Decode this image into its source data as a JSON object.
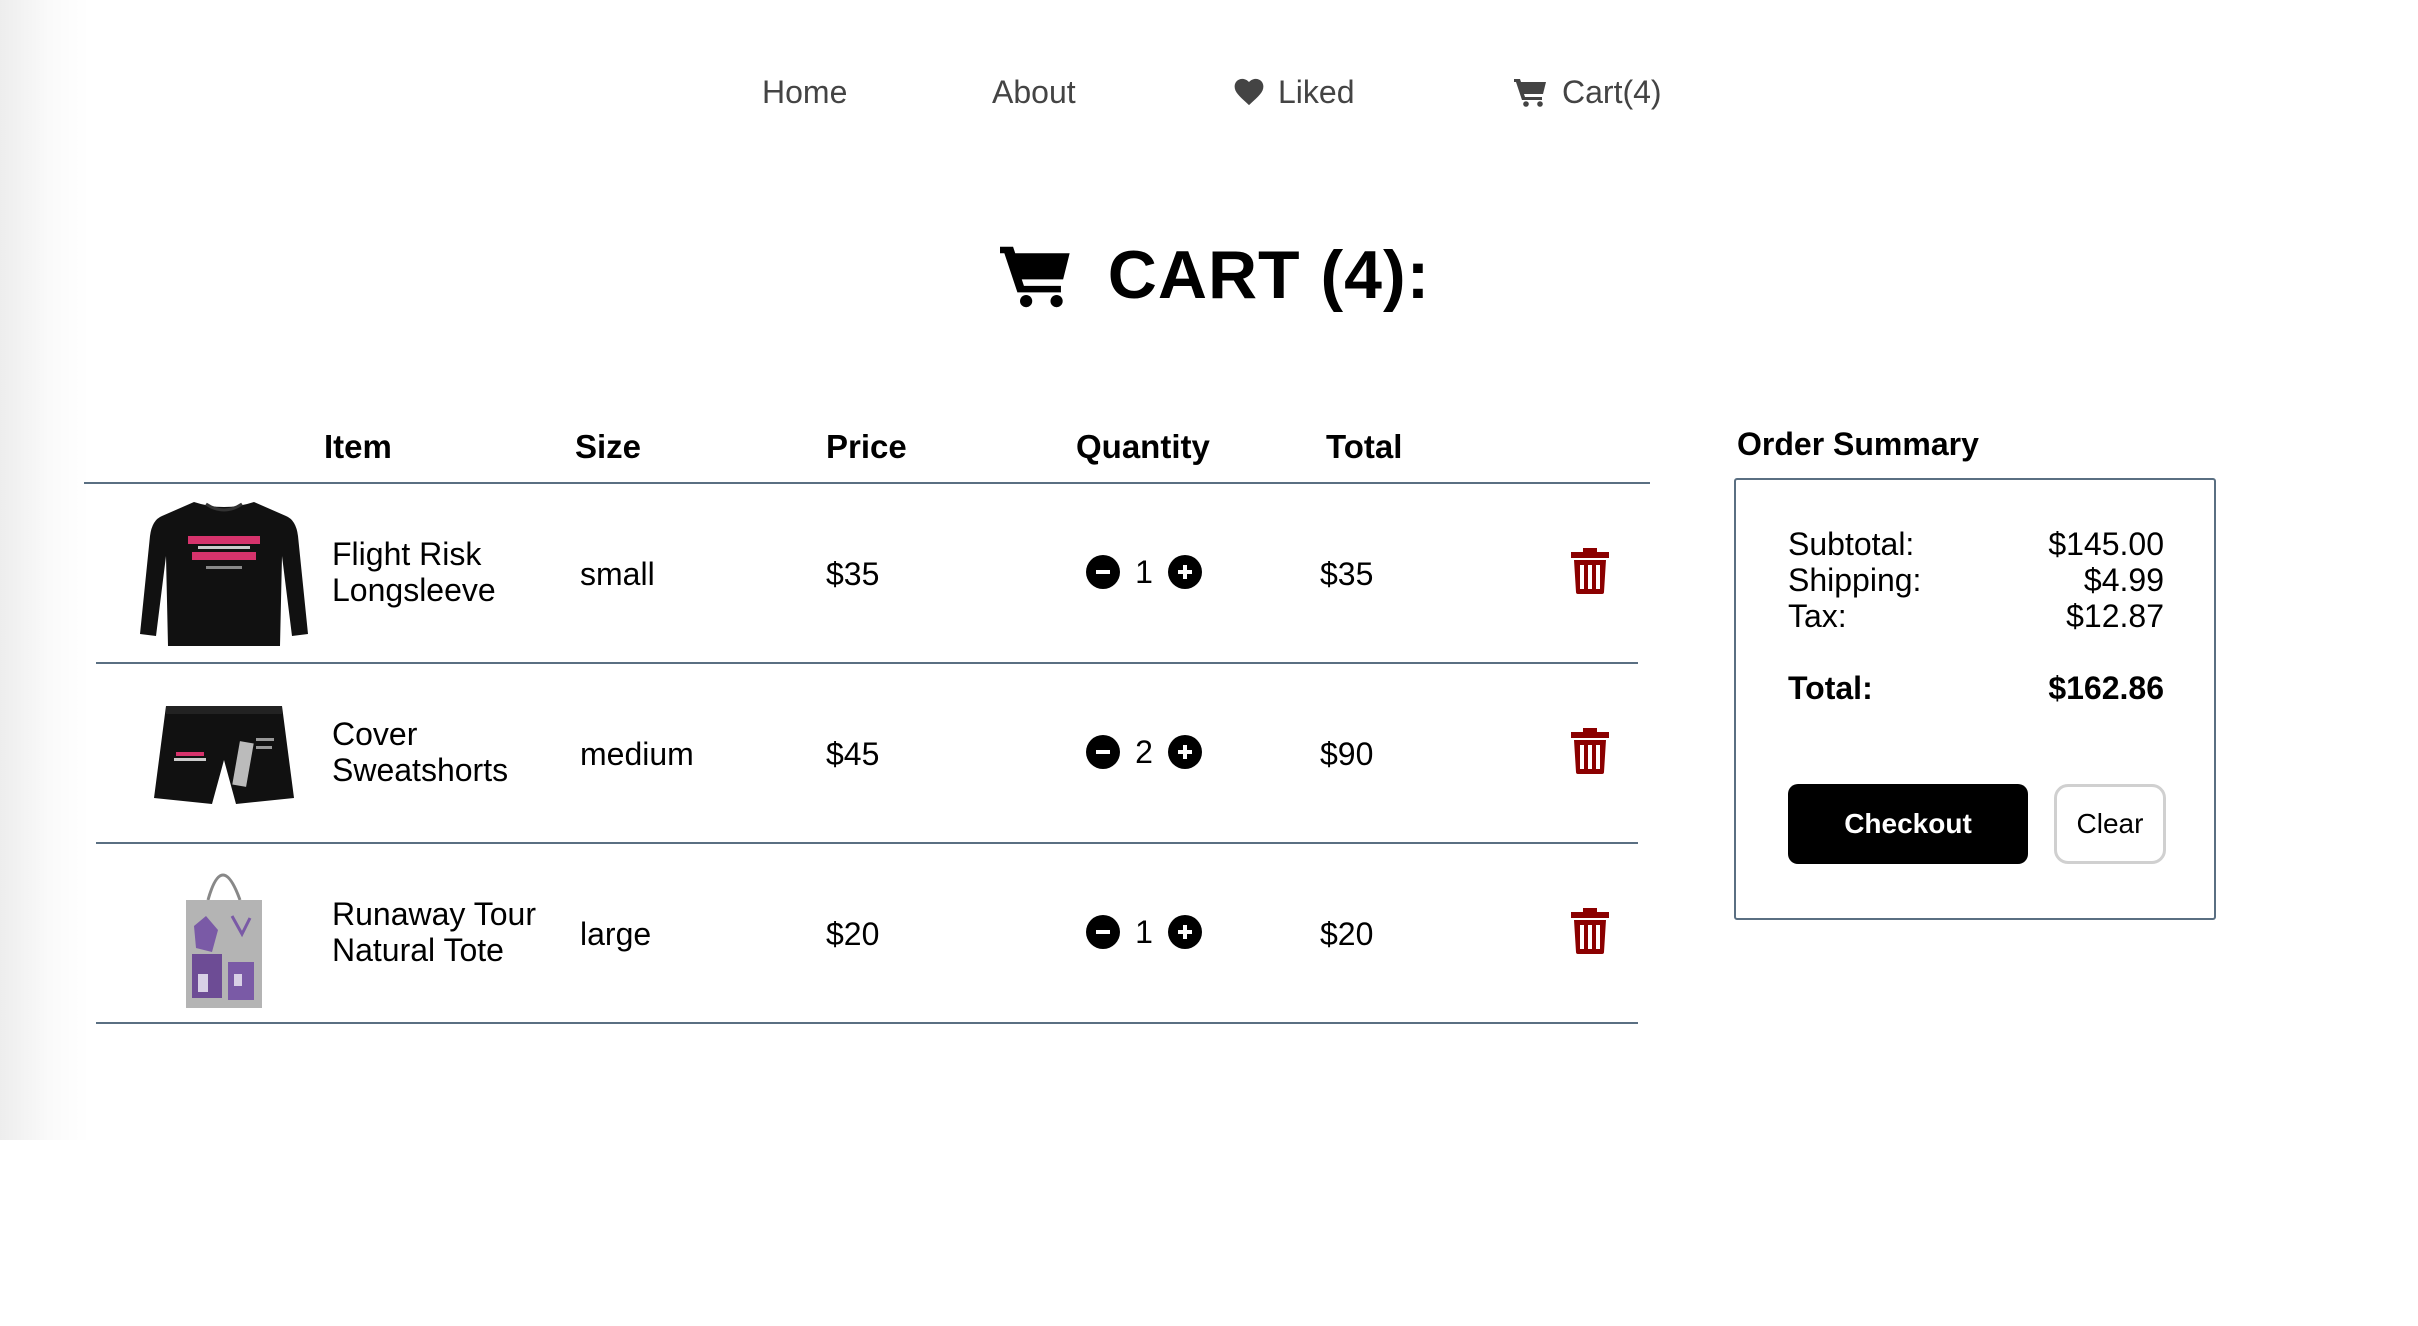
{
  "nav": {
    "home": "Home",
    "about": "About",
    "liked": "Liked",
    "cart": "Cart(4)"
  },
  "page_title": "CART (4):",
  "table": {
    "headers": [
      "Item",
      "Size",
      "Price",
      "Quantity",
      "Total"
    ],
    "rows": [
      {
        "name_line1": "Flight Risk",
        "name_line2": "Longsleeve",
        "size": "small",
        "price": "$35",
        "quantity": "1",
        "total": "$35",
        "thumb": "black-longsleeve-image"
      },
      {
        "name_line1": "Cover",
        "name_line2": "Sweatshorts",
        "size": "medium",
        "price": "$45",
        "quantity": "2",
        "total": "$90",
        "thumb": "black-sweatshorts-image"
      },
      {
        "name_line1": "Runaway Tour",
        "name_line2": "Natural Tote",
        "size": "large",
        "price": "$20",
        "quantity": "1",
        "total": "$20",
        "thumb": "grey-tote-image"
      }
    ]
  },
  "summary": {
    "title": "Order Summary",
    "subtotal_label": "Subtotal:",
    "subtotal": "$145.00",
    "shipping_label": "Shipping:",
    "shipping": "$4.99",
    "tax_label": "Tax:",
    "tax": "$12.87",
    "total_label": "Total:",
    "total": "$162.86",
    "checkout_label": "Checkout",
    "clear_label": "Clear"
  },
  "colors": {
    "delete_icon": "#8b0000",
    "divider": "#5a6f82",
    "nav_text": "#444444",
    "checkout_bg": "#000000"
  },
  "icons": {
    "nav_liked": "heart-icon",
    "nav_cart": "cart-icon",
    "title": "cart-icon",
    "qty_minus": "minus-circle-icon",
    "qty_plus": "plus-circle-icon",
    "delete": "trash-icon"
  }
}
